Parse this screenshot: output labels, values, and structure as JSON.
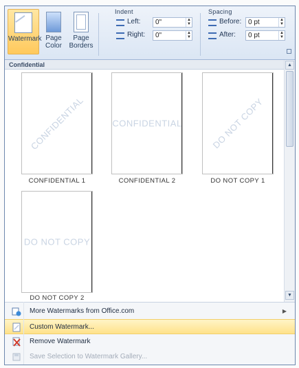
{
  "ribbon": {
    "buttons": [
      {
        "id": "watermark",
        "label": "Watermark"
      },
      {
        "id": "page_color",
        "label": "Page Color"
      },
      {
        "id": "page_borders",
        "label": "Page Borders"
      }
    ],
    "indent": {
      "title": "Indent",
      "left_label": "Left:",
      "left_value": "0\"",
      "right_label": "Right:",
      "right_value": "0\""
    },
    "spacing": {
      "title": "Spacing",
      "before_label": "Before:",
      "before_value": "0 pt",
      "after_label": "After:",
      "after_value": "0 pt"
    }
  },
  "gallery": {
    "section_title": "Confidential",
    "items": [
      {
        "caption": "CONFIDENTIAL 1",
        "watermark_text": "CONFIDENTIAL",
        "orientation": "diagonal"
      },
      {
        "caption": "CONFIDENTIAL 2",
        "watermark_text": "CONFIDENTIAL",
        "orientation": "horizontal"
      },
      {
        "caption": "DO NOT COPY 1",
        "watermark_text": "DO NOT COPY",
        "orientation": "diagonal"
      },
      {
        "caption": "DO NOT COPY 2",
        "watermark_text": "DO NOT COPY",
        "orientation": "horizontal"
      }
    ]
  },
  "menu": {
    "items": [
      {
        "label": "More Watermarks from Office.com",
        "icon": "office-online-icon",
        "has_submenu": true,
        "highlighted": false,
        "disabled": false
      },
      {
        "label": "Custom Watermark...",
        "icon": "custom-watermark-icon",
        "has_submenu": false,
        "highlighted": true,
        "disabled": false
      },
      {
        "label": "Remove Watermark",
        "icon": "remove-watermark-icon",
        "has_submenu": false,
        "highlighted": false,
        "disabled": false
      },
      {
        "label": "Save Selection to Watermark Gallery...",
        "icon": "save-selection-icon",
        "has_submenu": false,
        "highlighted": false,
        "disabled": true
      }
    ]
  },
  "colors": {
    "highlight": "#ffe28a",
    "ribbon_accent": "#ffc95c",
    "watermark_text": "#c9d4e3"
  }
}
